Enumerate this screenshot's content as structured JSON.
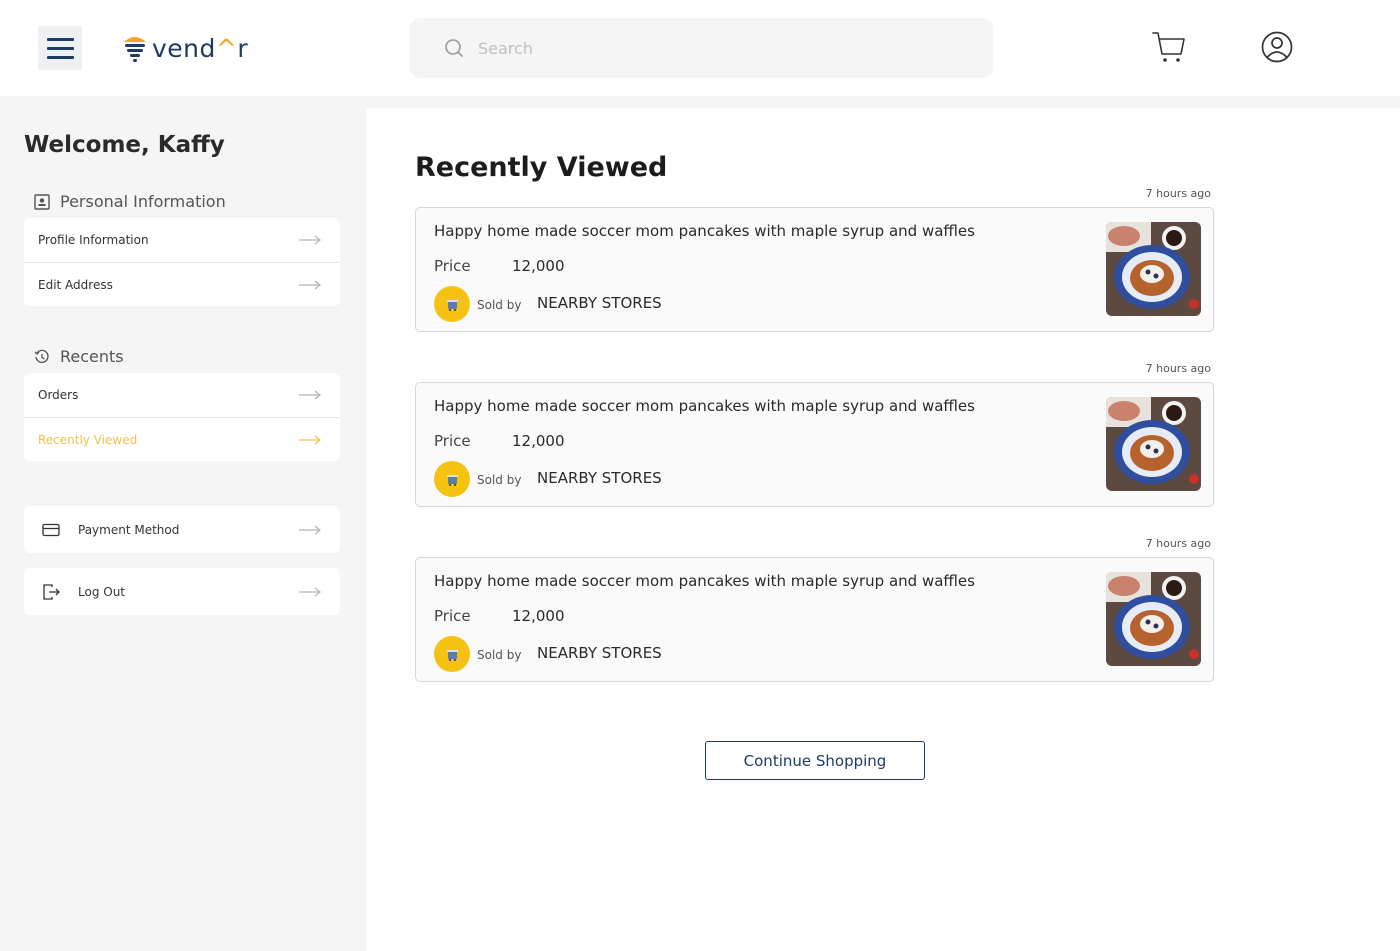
{
  "header": {
    "logo_text_a": "vend",
    "logo_text_b": "^",
    "logo_text_c": "r",
    "search_placeholder": "Search"
  },
  "sidebar": {
    "welcome": "Welcome, Kaffy",
    "personal_title": "Personal Information",
    "personal_items": [
      {
        "label": "Profile Information"
      },
      {
        "label": "Edit Address"
      }
    ],
    "recents_title": "Recents",
    "recents_items": [
      {
        "label": "Orders"
      },
      {
        "label": "Recently Viewed"
      }
    ],
    "payment_label": "Payment Method",
    "logout_label": "Log Out"
  },
  "main": {
    "title": "Recently Viewed",
    "items": [
      {
        "time": "7 hours ago",
        "title": "Happy home made soccer mom pancakes with maple syrup and waffles",
        "price_label": "Price",
        "price": "12,000",
        "sold_by": "Sold by",
        "store": "NEARBY STORES"
      },
      {
        "time": "7 hours ago",
        "title": "Happy home made soccer mom pancakes with maple syrup and waffles",
        "price_label": "Price",
        "price": "12,000",
        "sold_by": "Sold by",
        "store": "NEARBY STORES"
      },
      {
        "time": "7 hours ago",
        "title": "Happy home made soccer mom pancakes with maple syrup and waffles",
        "price_label": "Price",
        "price": "12,000",
        "sold_by": "Sold by",
        "store": "NEARBY STORES"
      }
    ],
    "continue_label": "Continue Shopping"
  },
  "colors": {
    "brand_navy": "#1d3b63",
    "accent_yellow": "#f2c14a",
    "badge_yellow": "#f5c211"
  }
}
